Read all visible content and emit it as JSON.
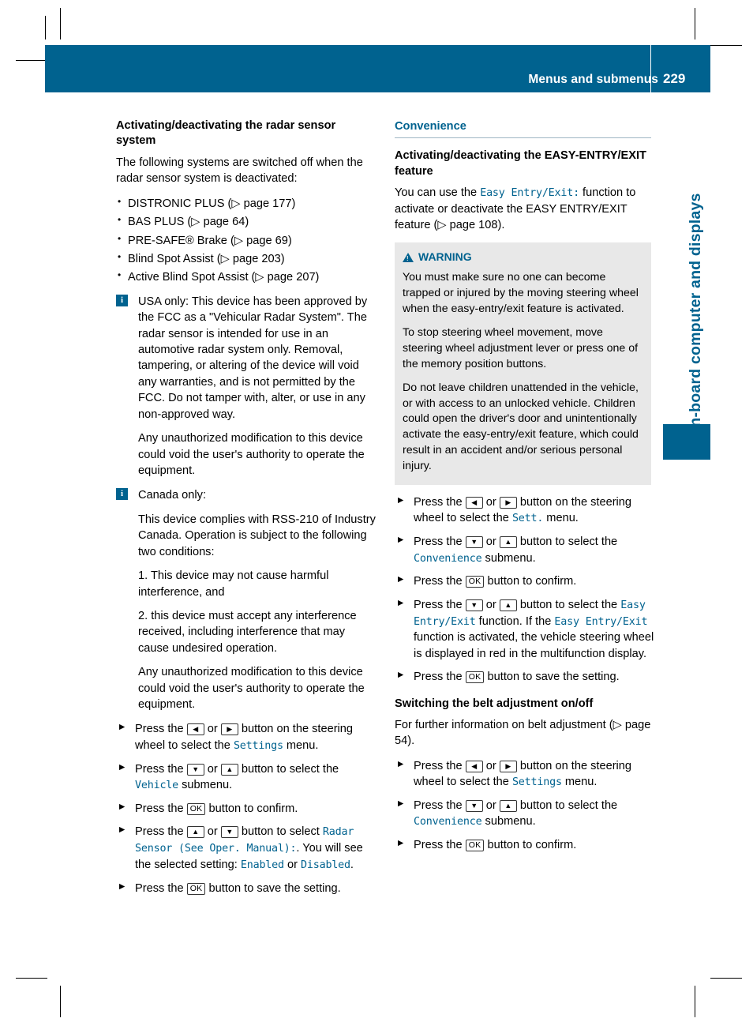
{
  "header": {
    "title": "Menus and submenus",
    "page_number": "229"
  },
  "side_tab": {
    "label": "On-board computer and displays"
  },
  "left_column": {
    "heading": "Activating/deactivating the radar sensor system",
    "intro": "The following systems are switched off when the radar sensor system is deactivated:",
    "bullets": [
      "DISTRONIC PLUS (▷ page 177)",
      "BAS PLUS (▷ page 64)",
      "PRE-SAFE® Brake (▷ page 69)",
      "Blind Spot Assist (▷ page 203)",
      "Active Blind Spot Assist (▷ page 207)"
    ],
    "info_1": [
      "USA only: This device has been approved by the FCC as a \"Vehicular Radar System\". The radar sensor is intended for use in an automotive radar system only. Removal, tampering, or altering of the device will void any warranties, and is not permitted by the FCC. Do not tamper with, alter, or use in any non-approved way.",
      "Any unauthorized modification to this device could void the user's authority to operate the equipment."
    ],
    "info_2": [
      "Canada only:",
      "This device complies with RSS-210 of Industry Canada. Operation is subject to the following two conditions:",
      "1. This device may not cause harmful interference, and",
      "2. this device must accept any interference received, including interference that may cause undesired operation.",
      "Any unauthorized modification to this device could void the user's authority to operate the equipment."
    ],
    "steps": [
      {
        "parts": [
          {
            "t": "text",
            "v": "Press the "
          },
          {
            "t": "key",
            "v": "◀"
          },
          {
            "t": "text",
            "v": " or "
          },
          {
            "t": "key",
            "v": "▶"
          },
          {
            "t": "text",
            "v": " button on the steering wheel to select the "
          },
          {
            "t": "mono",
            "v": "Settings"
          },
          {
            "t": "text",
            "v": " menu."
          }
        ]
      },
      {
        "parts": [
          {
            "t": "text",
            "v": "Press the "
          },
          {
            "t": "key",
            "v": "▼"
          },
          {
            "t": "text",
            "v": " or "
          },
          {
            "t": "key",
            "v": "▲"
          },
          {
            "t": "text",
            "v": " button to select the "
          },
          {
            "t": "mono",
            "v": "Vehicle"
          },
          {
            "t": "text",
            "v": " submenu."
          }
        ]
      },
      {
        "parts": [
          {
            "t": "text",
            "v": "Press the "
          },
          {
            "t": "keyok",
            "v": "OK"
          },
          {
            "t": "text",
            "v": " button to confirm."
          }
        ]
      },
      {
        "parts": [
          {
            "t": "text",
            "v": "Press the "
          },
          {
            "t": "key",
            "v": "▲"
          },
          {
            "t": "text",
            "v": " or "
          },
          {
            "t": "key",
            "v": "▼"
          },
          {
            "t": "text",
            "v": " button to select "
          },
          {
            "t": "mono",
            "v": "Radar Sensor (See Oper. Manual):"
          },
          {
            "t": "text",
            "v": ". You will see the selected setting: "
          },
          {
            "t": "mono",
            "v": "Enabled"
          },
          {
            "t": "text",
            "v": " or "
          },
          {
            "t": "mono",
            "v": "Disabled"
          },
          {
            "t": "text",
            "v": "."
          }
        ]
      },
      {
        "parts": [
          {
            "t": "text",
            "v": "Press the "
          },
          {
            "t": "keyok",
            "v": "OK"
          },
          {
            "t": "text",
            "v": " button to save the setting."
          }
        ]
      }
    ]
  },
  "right_column": {
    "section_heading": "Convenience",
    "heading": "Activating/deactivating the EASY-ENTRY/EXIT feature",
    "intro_parts": [
      {
        "t": "text",
        "v": "You can use the "
      },
      {
        "t": "mono",
        "v": "Easy Entry/Exit:"
      },
      {
        "t": "text",
        "v": " function to activate or deactivate the EASY ENTRY/EXIT feature (▷ page 108)."
      }
    ],
    "warning": {
      "label": "WARNING",
      "paragraphs": [
        "You must make sure no one can become trapped or injured by the moving steering wheel when the easy-entry/exit feature is activated.",
        "To stop steering wheel movement, move steering wheel adjustment lever or press one of the memory position buttons.",
        "Do not leave children unattended in the vehicle, or with access to an unlocked vehicle. Children could open the driver's door and unintentionally activate the easy-entry/exit feature, which could result in an accident and/or serious personal injury."
      ]
    },
    "steps": [
      {
        "parts": [
          {
            "t": "text",
            "v": "Press the "
          },
          {
            "t": "key",
            "v": "◀"
          },
          {
            "t": "text",
            "v": " or "
          },
          {
            "t": "key",
            "v": "▶"
          },
          {
            "t": "text",
            "v": " button on the steering wheel to select the "
          },
          {
            "t": "mono",
            "v": "Sett."
          },
          {
            "t": "text",
            "v": " menu."
          }
        ]
      },
      {
        "parts": [
          {
            "t": "text",
            "v": "Press the "
          },
          {
            "t": "key",
            "v": "▼"
          },
          {
            "t": "text",
            "v": " or "
          },
          {
            "t": "key",
            "v": "▲"
          },
          {
            "t": "text",
            "v": " button to select the "
          },
          {
            "t": "mono",
            "v": "Convenience"
          },
          {
            "t": "text",
            "v": " submenu."
          }
        ]
      },
      {
        "parts": [
          {
            "t": "text",
            "v": "Press the "
          },
          {
            "t": "keyok",
            "v": "OK"
          },
          {
            "t": "text",
            "v": " button to confirm."
          }
        ]
      },
      {
        "parts": [
          {
            "t": "text",
            "v": "Press the "
          },
          {
            "t": "key",
            "v": "▼"
          },
          {
            "t": "text",
            "v": " or "
          },
          {
            "t": "key",
            "v": "▲"
          },
          {
            "t": "text",
            "v": " button to select the "
          },
          {
            "t": "mono",
            "v": "Easy Entry/Exit"
          },
          {
            "t": "text",
            "v": " function. If the "
          },
          {
            "t": "mono",
            "v": "Easy Entry/Exit"
          },
          {
            "t": "text",
            "v": " function is activated, the vehicle steering wheel is displayed in red in the multifunction display."
          }
        ]
      },
      {
        "parts": [
          {
            "t": "text",
            "v": "Press the "
          },
          {
            "t": "keyok",
            "v": "OK"
          },
          {
            "t": "text",
            "v": " button to save the setting."
          }
        ]
      }
    ],
    "belt_heading": "Switching the belt adjustment on/off",
    "belt_intro": "For further information on belt adjustment (▷ page 54).",
    "belt_steps": [
      {
        "parts": [
          {
            "t": "text",
            "v": "Press the "
          },
          {
            "t": "key",
            "v": "◀"
          },
          {
            "t": "text",
            "v": " or "
          },
          {
            "t": "key",
            "v": "▶"
          },
          {
            "t": "text",
            "v": " button on the steering wheel to select the "
          },
          {
            "t": "mono",
            "v": "Settings"
          },
          {
            "t": "text",
            "v": " menu."
          }
        ]
      },
      {
        "parts": [
          {
            "t": "text",
            "v": "Press the "
          },
          {
            "t": "key",
            "v": "▼"
          },
          {
            "t": "text",
            "v": " or "
          },
          {
            "t": "key",
            "v": "▲"
          },
          {
            "t": "text",
            "v": " button to select the "
          },
          {
            "t": "mono",
            "v": "Convenience"
          },
          {
            "t": "text",
            "v": " submenu."
          }
        ]
      },
      {
        "parts": [
          {
            "t": "text",
            "v": "Press the "
          },
          {
            "t": "keyok",
            "v": "OK"
          },
          {
            "t": "text",
            "v": " button to confirm."
          }
        ]
      }
    ]
  },
  "icons": {
    "info": "i",
    "warning": "warning-triangle-icon",
    "step_marker": "step-arrow-icon"
  },
  "colors": {
    "accent": "#00628f",
    "warning_bg": "#e8e8e8",
    "rule": "#9fb6c4"
  }
}
